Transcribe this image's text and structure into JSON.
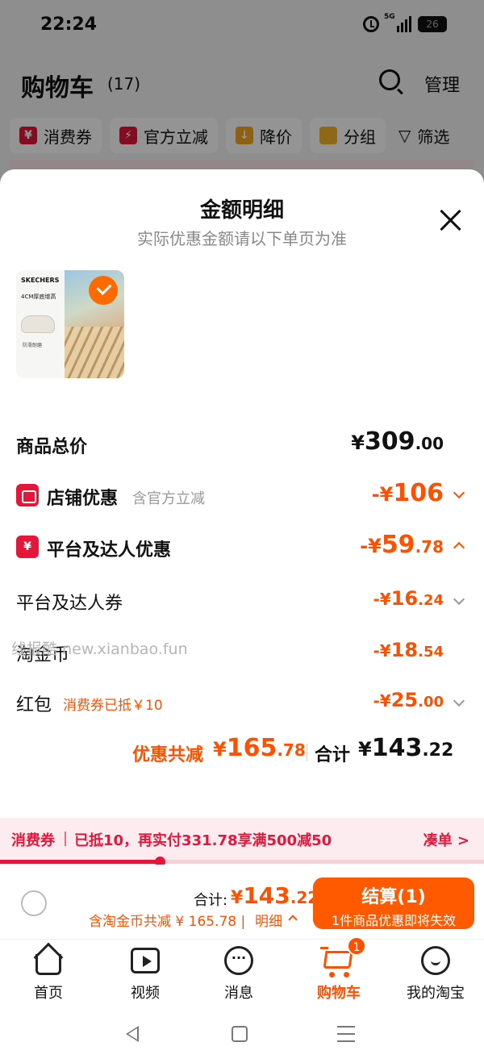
{
  "status_bar": {
    "time": "22:24",
    "network": "5G",
    "battery": "26"
  },
  "cart_header": {
    "title": "购物车",
    "count": "(17)",
    "manage_label": "管理"
  },
  "filters": [
    {
      "label": "消费券",
      "icon": "coupon-icon"
    },
    {
      "label": "官方立减",
      "icon": "lightning-icon"
    },
    {
      "label": "降价",
      "icon": "arrow-down-icon"
    },
    {
      "label": "分组",
      "icon": "folder-icon"
    },
    {
      "label": "筛选",
      "icon": "filter-icon"
    }
  ],
  "sheet": {
    "title": "金额明细",
    "subtitle": "实际优惠金额请以下单页为准",
    "product": {
      "brand": "SKECHERS",
      "tagline": "4CM厚底增高",
      "caption": "防滑耐磨"
    },
    "goods_total": {
      "label": "商品总价",
      "yen": "¥",
      "int": "309",
      "dec": ".00"
    },
    "store_discount": {
      "label": "店铺优惠",
      "note": "含官方立减",
      "prefix": "-¥",
      "int": "106",
      "dec": ""
    },
    "platform_discount": {
      "label": "平台及达人优惠",
      "prefix": "-¥",
      "int": "59",
      "dec": ".78"
    },
    "platform_coupon": {
      "label": "平台及达人券",
      "prefix": "-¥",
      "int": "16",
      "dec": ".24"
    },
    "taojinbi": {
      "label": "淘金币",
      "prefix": "-¥",
      "int": "18",
      "dec": ".54"
    },
    "red_packet": {
      "label": "红包",
      "note": "消费券已抵￥10",
      "prefix": "-¥",
      "int": "25",
      "dec": ".00"
    },
    "summary": {
      "discount_label": "优惠共减",
      "discount_yen": "¥",
      "discount_int": "165",
      "discount_dec": ".78",
      "total_label": "合计",
      "total_yen": "¥",
      "total_int": "143",
      "total_dec": ".22"
    },
    "watermark": "线报酷 new.xianbao.fun"
  },
  "coupon_strip": {
    "lead": "消费券",
    "message": "已抵10，再实付331.78享满500减50",
    "action": "凑单 >",
    "progress": 0.33
  },
  "checkout": {
    "total_label": "合计:",
    "total_yen": "¥",
    "total_int": "143",
    "total_dec": ".22",
    "sub": "含淘金币共减 ¥ 165.78 |",
    "detail": "明细",
    "pay_label": "结算(1)",
    "pay_sub": "1件商品优惠即将失效"
  },
  "tabs": [
    {
      "label": "首页",
      "icon": "home-icon"
    },
    {
      "label": "视频",
      "icon": "video-icon"
    },
    {
      "label": "消息",
      "icon": "message-icon"
    },
    {
      "label": "购物车",
      "icon": "cart-icon",
      "badge": "1",
      "active": true
    },
    {
      "label": "我的淘宝",
      "icon": "profile-icon"
    }
  ],
  "colors": {
    "accent": "#ff5000",
    "red": "#e4163a",
    "pay_button": "#ff5a00"
  }
}
